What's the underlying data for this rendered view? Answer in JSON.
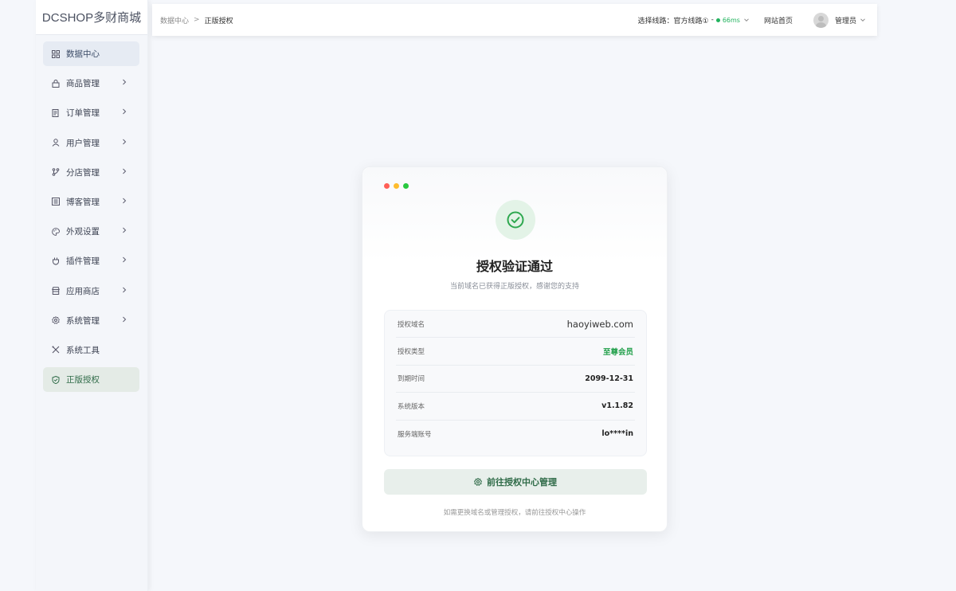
{
  "sidebar": {
    "logo": "DCSHOP多财商城",
    "items": [
      {
        "label": "数据中心",
        "icon": "dashboard-icon"
      },
      {
        "label": "商品管理",
        "icon": "bag-icon"
      },
      {
        "label": "订单管理",
        "icon": "order-icon"
      },
      {
        "label": "用户管理",
        "icon": "user-icon"
      },
      {
        "label": "分店管理",
        "icon": "branch-icon"
      },
      {
        "label": "博客管理",
        "icon": "blog-icon"
      },
      {
        "label": "外观设置",
        "icon": "palette-icon"
      },
      {
        "label": "插件管理",
        "icon": "plugin-icon"
      },
      {
        "label": "应用商店",
        "icon": "store-icon"
      },
      {
        "label": "系统管理",
        "icon": "gear-icon"
      },
      {
        "label": "系统工具",
        "icon": "tools-icon"
      },
      {
        "label": "正版授权",
        "icon": "shield-check-icon"
      }
    ]
  },
  "header": {
    "breadcrumb": [
      "数据中心",
      "正版授权"
    ],
    "breadcrumb_separator": ">",
    "line_label": "选择线路：",
    "line_value": "官方线路①",
    "line_dash": "-",
    "ping": "66ms",
    "home_link": "网站首页",
    "user_name": "管理员"
  },
  "card": {
    "title": "授权验证通过",
    "subtitle": "当前域名已获得正版授权，感谢您的支持",
    "rows": [
      {
        "label": "授权域名",
        "value": "haoyiweb.com"
      },
      {
        "label": "授权类型",
        "value": "至尊会员"
      },
      {
        "label": "到期时间",
        "value": "2099-12-31"
      },
      {
        "label": "系统版本",
        "value": "v1.1.82"
      },
      {
        "label": "服务端账号",
        "value": "lo****in"
      }
    ],
    "button_label": "前往授权中心管理",
    "footer_note": "如需更换域名或管理授权，请前往授权中心操作"
  },
  "colors": {
    "accent_green": "#22a04b",
    "ping_green": "#22b35e",
    "dot_red": "#ff5f57",
    "dot_yellow": "#febc2e",
    "dot_green": "#28c840"
  }
}
